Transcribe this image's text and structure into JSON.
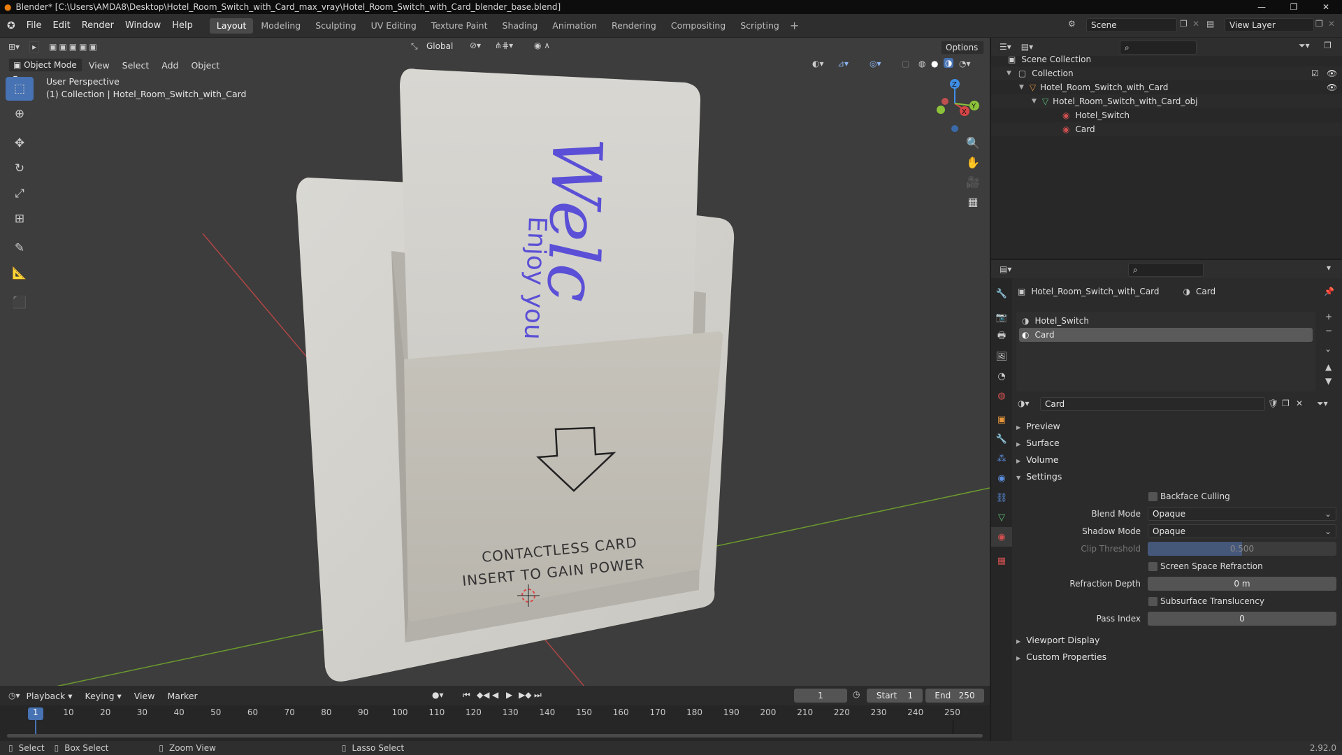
{
  "window": {
    "title": "Blender* [C:\\Users\\AMDA8\\Desktop\\Hotel_Room_Switch_with_Card_max_vray\\Hotel_Room_Switch_with_Card_blender_base.blend]"
  },
  "menu": [
    "File",
    "Edit",
    "Render",
    "Window",
    "Help"
  ],
  "workspaces": [
    "Layout",
    "Modeling",
    "Sculpting",
    "UV Editing",
    "Texture Paint",
    "Shading",
    "Animation",
    "Rendering",
    "Compositing",
    "Scripting"
  ],
  "active_workspace": "Layout",
  "scene": {
    "label": "Scene",
    "view_layer": "View Layer"
  },
  "viewport": {
    "mode": "Object Mode",
    "menus": [
      "View",
      "Select",
      "Add",
      "Object"
    ],
    "transform_orientation": "Global",
    "options_label": "Options",
    "info_line1": "User Perspective",
    "info_line2": "(1) Collection | Hotel_Room_Switch_with_Card",
    "gizmo_axes": {
      "x": "X",
      "y": "Y",
      "z": "Z"
    },
    "card_text_main": "Welc",
    "card_text_sub": "Enjoy you",
    "slot_text_line1": "CONTACTLESS CARD",
    "slot_text_line2": "INSERT TO GAIN POWER"
  },
  "outliner": {
    "root": "Scene Collection",
    "items": [
      {
        "label": "Collection"
      },
      {
        "label": "Hotel_Room_Switch_with_Card"
      },
      {
        "label": "Hotel_Room_Switch_with_Card_obj"
      },
      {
        "label": "Hotel_Switch"
      },
      {
        "label": "Card"
      }
    ]
  },
  "properties": {
    "breadcrumb_object": "Hotel_Room_Switch_with_Card",
    "breadcrumb_material": "Card",
    "slots": [
      "Hotel_Switch",
      "Card"
    ],
    "active_slot": "Card",
    "material_name": "Card",
    "panels": {
      "preview": "Preview",
      "surface": "Surface",
      "volume": "Volume",
      "settings": "Settings",
      "viewport_display": "Viewport Display",
      "custom_properties": "Custom Properties"
    },
    "settings": {
      "backface_culling_label": "Backface Culling",
      "blend_mode_label": "Blend Mode",
      "blend_mode_value": "Opaque",
      "shadow_mode_label": "Shadow Mode",
      "shadow_mode_value": "Opaque",
      "clip_threshold_label": "Clip Threshold",
      "clip_threshold_value": "0.500",
      "ssr_label": "Screen Space Refraction",
      "refraction_depth_label": "Refraction Depth",
      "refraction_depth_value": "0 m",
      "subsurface_label": "Subsurface Translucency",
      "pass_index_label": "Pass Index",
      "pass_index_value": "0"
    }
  },
  "timeline": {
    "menus": [
      "Playback",
      "Keying",
      "View",
      "Marker"
    ],
    "current_frame": "1",
    "start_label": "Start",
    "start_value": "1",
    "end_label": "End",
    "end_value": "250",
    "ticks": [
      "1",
      "10",
      "20",
      "30",
      "40",
      "50",
      "60",
      "70",
      "80",
      "90",
      "100",
      "110",
      "120",
      "130",
      "140",
      "150",
      "160",
      "170",
      "180",
      "190",
      "200",
      "210",
      "220",
      "230",
      "240",
      "250"
    ]
  },
  "statusbar": {
    "select": "Select",
    "box_select": "Box Select",
    "zoom_view": "Zoom View",
    "lasso_select": "Lasso Select",
    "version": "2.92.0"
  },
  "colors": {
    "accent": "#4772b3",
    "viewport_bg": "#3d3d3d",
    "card_text": "#5a4fd6",
    "axis_x": "#d64545",
    "axis_y": "#8cc23a",
    "axis_z": "#3f8ee6"
  }
}
